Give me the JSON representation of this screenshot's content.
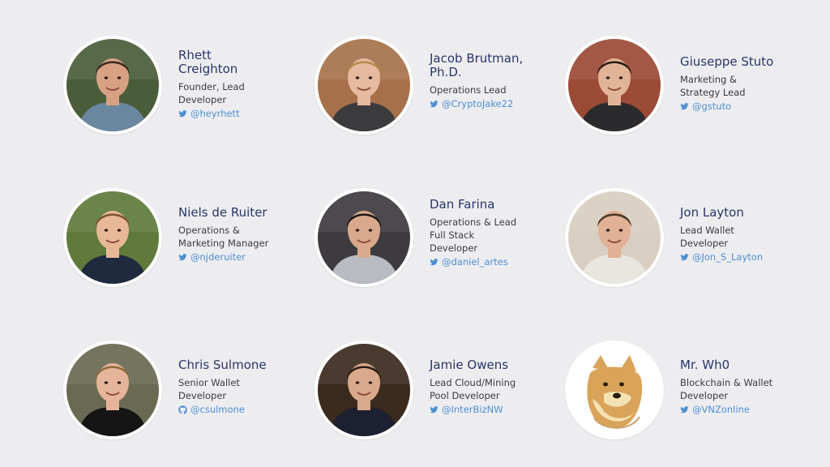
{
  "team": [
    {
      "name": "Rhett Creighton",
      "name_lines": [
        "Rhett",
        "Creighton"
      ],
      "role_lines": [
        "Founder, Lead",
        "Developer"
      ],
      "handle": "@heyrhett",
      "social_icon": "twitter-icon",
      "photo": {
        "bg": "#4a5d3a",
        "skin": "#d8a184",
        "hair": "#3b2a20",
        "shirt": "#6b87a0"
      }
    },
    {
      "name": "Jacob Brutman, Ph.D.",
      "name_lines": [
        "Jacob Brutman,",
        "Ph.D."
      ],
      "role_lines": [
        "Operations Lead"
      ],
      "handle": "@CryptoJake22",
      "social_icon": "twitter-icon",
      "photo": {
        "bg": "#a6714a",
        "skin": "#e6b9a0",
        "hair": "#b88a4a",
        "shirt": "#3b3b3e"
      }
    },
    {
      "name": "Giuseppe Stuto",
      "name_lines": [
        "Giuseppe Stuto"
      ],
      "role_lines": [
        "Marketing &",
        "Strategy Lead"
      ],
      "handle": "@gstuto",
      "social_icon": "twitter-icon",
      "photo": {
        "bg": "#9b4a35",
        "skin": "#e2b497",
        "hair": "#2a1c14",
        "shirt": "#2b2b2d"
      }
    },
    {
      "name": "Niels de Ruiter",
      "name_lines": [
        "Niels de Ruiter"
      ],
      "role_lines": [
        "Operations &",
        "Marketing Manager"
      ],
      "handle": "@njderuiter",
      "social_icon": "twitter-icon",
      "photo": {
        "bg": "#5f7a3a",
        "skin": "#e8b896",
        "hair": "#7a5234",
        "shirt": "#1f2a3f"
      }
    },
    {
      "name": "Dan Farina",
      "name_lines": [
        "Dan Farina"
      ],
      "role_lines": [
        "Operations & Lead",
        "Full Stack",
        "Developer"
      ],
      "handle": "@daniel_artes",
      "social_icon": "twitter-icon",
      "photo": {
        "bg": "#3d3b40",
        "skin": "#d9a98c",
        "hair": "#1c1814",
        "shirt": "#b8bcc2"
      }
    },
    {
      "name": "Jon Layton",
      "name_lines": [
        "Jon Layton"
      ],
      "role_lines": [
        "Lead Wallet",
        "Developer"
      ],
      "handle": "@Jon_S_Layton",
      "social_icon": "twitter-icon",
      "photo": {
        "bg": "#d8cfc2",
        "skin": "#e0b196",
        "hair": "#4a3626",
        "shirt": "#e9e6e0"
      }
    },
    {
      "name": "Chris Sulmone",
      "name_lines": [
        "Chris Sulmone"
      ],
      "role_lines": [
        "Senior Wallet",
        "Developer"
      ],
      "handle": "@csulmone",
      "social_icon": "github-icon",
      "photo": {
        "bg": "#6a6a52",
        "skin": "#e6b49a",
        "hair": "#8a6a3a",
        "shirt": "#151515"
      }
    },
    {
      "name": "Jamie Owens",
      "name_lines": [
        "Jamie Owens"
      ],
      "role_lines": [
        "Lead Cloud/Mining",
        "Pool Developer"
      ],
      "handle": "@InterBizNW",
      "social_icon": "twitter-icon",
      "photo": {
        "bg": "#3b2a1e",
        "skin": "#d8a98a",
        "hair": "#2a1c12",
        "shirt": "#1c2030"
      }
    },
    {
      "name": "Mr. Wh0",
      "name_lines": [
        "Mr. Wh0"
      ],
      "role_lines": [
        "Blockchain & Wallet",
        "Developer"
      ],
      "handle": "@VNZonline",
      "social_icon": "twitter-icon",
      "photo": {
        "bg": "#ffffff",
        "skin": "#d9a35a",
        "hair": "#f3e3b4",
        "shirt": "#ffffff",
        "kind": "doge-logo"
      }
    }
  ],
  "colors": {
    "name": "#2a3566",
    "role": "#3c3c3c",
    "link": "#4d8fd0",
    "background": "#ededf0"
  }
}
